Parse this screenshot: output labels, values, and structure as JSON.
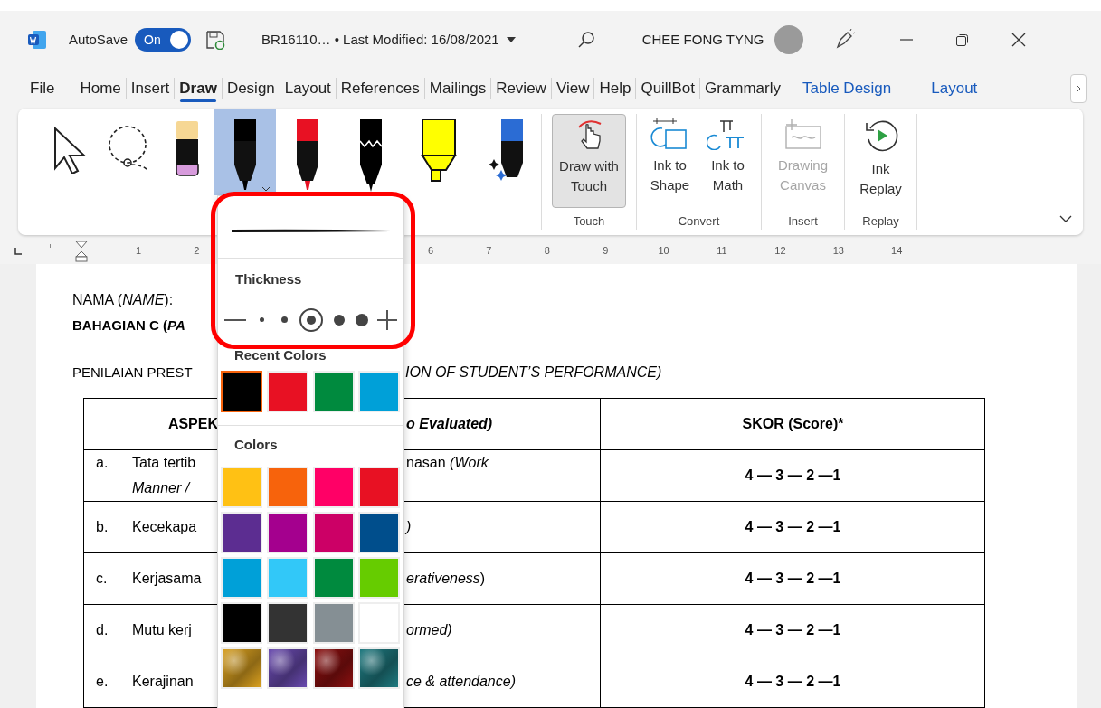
{
  "title_bar": {
    "autosave_label": "AutoSave",
    "autosave": {
      "label": "On",
      "on": true
    },
    "document_title": "BR16110… • Last Modified: 16/08/2021",
    "user_name": "CHEE FONG TYNG"
  },
  "tabs": [
    {
      "label": "File",
      "selected": false,
      "kind": "normal"
    },
    {
      "label": "Home",
      "selected": false,
      "kind": "normal"
    },
    {
      "label": "Insert",
      "selected": false,
      "kind": "normal"
    },
    {
      "label": "Draw",
      "selected": true,
      "kind": "normal"
    },
    {
      "label": "Design",
      "selected": false,
      "kind": "normal"
    },
    {
      "label": "Layout",
      "selected": false,
      "kind": "normal"
    },
    {
      "label": "References",
      "selected": false,
      "kind": "normal"
    },
    {
      "label": "Mailings",
      "selected": false,
      "kind": "normal"
    },
    {
      "label": "Review",
      "selected": false,
      "kind": "normal"
    },
    {
      "label": "View",
      "selected": false,
      "kind": "normal"
    },
    {
      "label": "Help",
      "selected": false,
      "kind": "normal"
    },
    {
      "label": "QuillBot",
      "selected": false,
      "kind": "normal"
    },
    {
      "label": "Grammarly",
      "selected": false,
      "kind": "normal"
    },
    {
      "label": "Table Design",
      "selected": false,
      "kind": "contextual"
    },
    {
      "label": "Layout",
      "selected": false,
      "kind": "contextual"
    }
  ],
  "ribbon": {
    "tools": [
      {
        "kind": "select",
        "selected": false
      },
      {
        "kind": "lasso",
        "selected": false
      },
      {
        "kind": "eraser",
        "selected": false
      },
      {
        "kind": "pen",
        "color": "#000000",
        "selected": true
      },
      {
        "kind": "pen",
        "color": "#e81123",
        "selected": false
      },
      {
        "kind": "pattern",
        "color": "#000000",
        "selected": false
      },
      {
        "kind": "highlighter",
        "color": "#ffff00",
        "selected": false
      },
      {
        "kind": "action",
        "color": "#2b6cd4",
        "selected": false
      }
    ],
    "groups": [
      {
        "label": "Touch",
        "buttons": [
          {
            "label": "Draw with\nTouch",
            "kind": "touch",
            "pressed": true,
            "disabled": false
          }
        ]
      },
      {
        "label": "Convert",
        "buttons": [
          {
            "label": "Ink to\nShape",
            "kind": "shape",
            "pressed": false,
            "disabled": false
          },
          {
            "label": "Ink to\nMath",
            "kind": "math",
            "pressed": false,
            "disabled": false
          }
        ]
      },
      {
        "label": "Insert",
        "buttons": [
          {
            "label": "Drawing\nCanvas",
            "kind": "canvas",
            "pressed": false,
            "disabled": true
          }
        ]
      },
      {
        "label": "Replay",
        "buttons": [
          {
            "label": "Ink\nReplay",
            "kind": "replay",
            "pressed": false,
            "disabled": false
          }
        ]
      }
    ]
  },
  "ruler": {
    "left_labels": [
      "1",
      "2"
    ],
    "right_labels": [
      "6",
      "7",
      "8",
      "9",
      "10",
      "11",
      "12",
      "13",
      "14"
    ]
  },
  "document": {
    "name_line": "NAMA (*NAME*):",
    "section_line": "BAHAGIAN C (*PA*",
    "evaluation_left": "PENILAIAN PREST",
    "evaluation_right": "ION OF STUDENT’S PERFORMANCE)",
    "table": {
      "aspect_left": "ASPEK",
      "aspect_right": "o Evaluated)",
      "score_header": "SKOR (Score)*",
      "rows": [
        {
          "marker": "a.",
          "left": "Tata tertib",
          "left_line2": "Manner /",
          "right": "nasan *(Work*",
          "score": "4 — 3 — 2 —1"
        },
        {
          "marker": "b.",
          "left": "Kecekapa",
          "right": "*)*",
          "score": "4 — 3 — 2 —1"
        },
        {
          "marker": "c.",
          "left": "Kerjasama",
          "right": "*erativeness*)",
          "score": "4 — 3 — 2 —1"
        },
        {
          "marker": "d.",
          "left": "Mutu kerj",
          "right": "*ormed)*",
          "score": "4 — 3 — 2 —1"
        },
        {
          "marker": "e.",
          "left": "Kerajinan",
          "right": "*ce & attendance)*",
          "score": "4 — 3 — 2 —1"
        }
      ]
    }
  },
  "pen_menu": {
    "thickness_label": "Thickness",
    "thickness": [
      {
        "selected": false
      },
      {
        "selected": false
      },
      {
        "selected": true
      },
      {
        "selected": false
      },
      {
        "selected": false
      }
    ],
    "recent_label": "Recent Colors",
    "recent_colors": [
      {
        "color": "#000000",
        "selected": true
      },
      {
        "color": "#e81123",
        "selected": false
      },
      {
        "color": "#008a3e",
        "selected": false
      },
      {
        "color": "#00a0d8",
        "selected": false
      }
    ],
    "colors_label": "Colors",
    "colors": [
      {
        "kind": "solid",
        "color": "#ffc114"
      },
      {
        "kind": "solid",
        "color": "#f7630c"
      },
      {
        "kind": "solid",
        "color": "#ff0066"
      },
      {
        "kind": "solid",
        "color": "#e81123"
      },
      {
        "kind": "solid",
        "color": "#5c2d91"
      },
      {
        "kind": "solid",
        "color": "#a4008e"
      },
      {
        "kind": "solid",
        "color": "#cc0066"
      },
      {
        "kind": "solid",
        "color": "#004e8c"
      },
      {
        "kind": "solid",
        "color": "#00a0d8"
      },
      {
        "kind": "solid",
        "color": "#32c8f8"
      },
      {
        "kind": "solid",
        "color": "#008a3e"
      },
      {
        "kind": "solid",
        "color": "#66cc00"
      },
      {
        "kind": "solid",
        "color": "#000000"
      },
      {
        "kind": "solid",
        "color": "#333333"
      },
      {
        "kind": "solid",
        "color": "#858f94"
      },
      {
        "kind": "solid",
        "color": "#ffffff"
      },
      {
        "kind": "texture",
        "color": "#d9a020"
      },
      {
        "kind": "texture",
        "color": "#6a4bb0"
      },
      {
        "kind": "texture",
        "color": "#8b1010"
      },
      {
        "kind": "texture",
        "color": "#1f7a80"
      }
    ]
  }
}
